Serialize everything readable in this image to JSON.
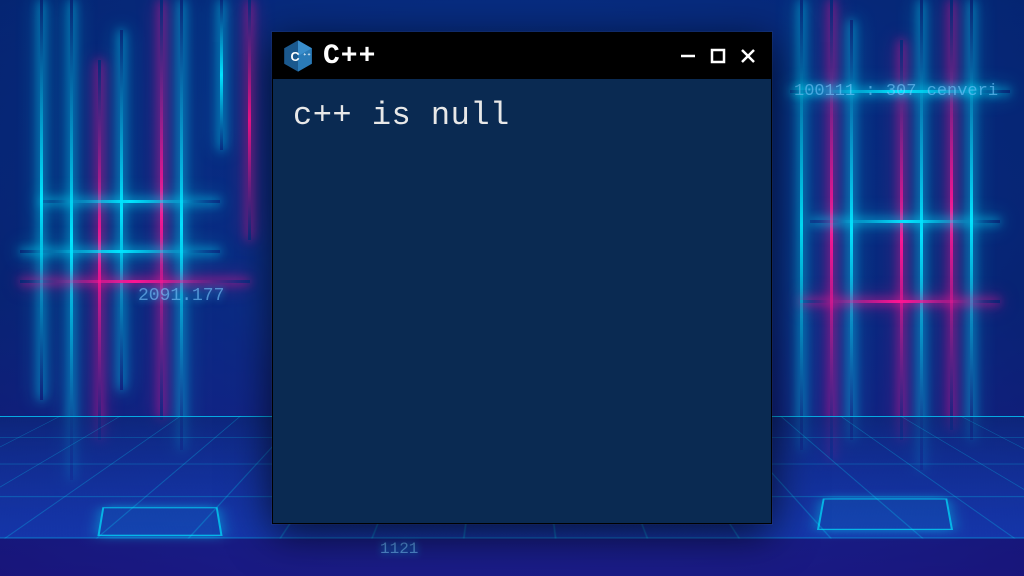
{
  "window": {
    "title": "C++",
    "icon": "cpp-logo"
  },
  "terminal": {
    "output": "c++ is null"
  },
  "background": {
    "text_left": "2091.177",
    "text_right": "100111 : 307  cenveri",
    "text_bottom": "1121"
  },
  "colors": {
    "terminal_bg": "#0a2a52",
    "titlebar_bg": "#000000",
    "text": "#e8e8e8",
    "neon_cyan": "#00e5ff",
    "neon_pink": "#ff1493"
  }
}
